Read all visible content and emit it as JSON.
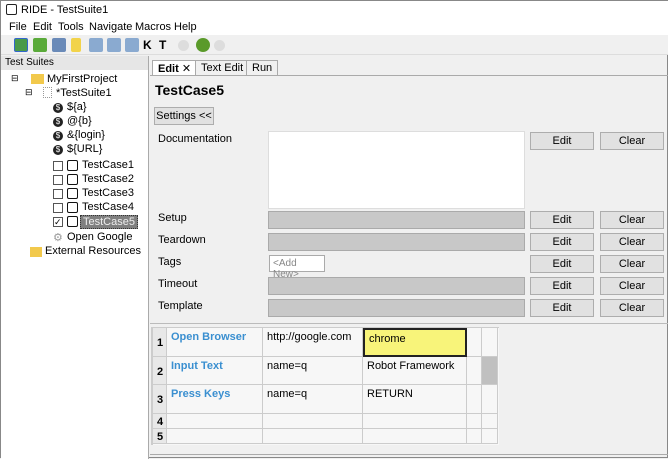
{
  "window": {
    "title": "RIDE - TestSuite1"
  },
  "menu": [
    "File",
    "Edit",
    "Tools",
    "Navigate",
    "Macros",
    "Help"
  ],
  "tree": {
    "header": "Test Suites",
    "project": "MyFirstProject",
    "suite": "*TestSuite1",
    "variables": [
      "${a}",
      "@{b}",
      "&{login}",
      "${URL}"
    ],
    "testcases": [
      {
        "name": "TestCase1",
        "checked": false
      },
      {
        "name": "TestCase2",
        "checked": false
      },
      {
        "name": "TestCase3",
        "checked": false
      },
      {
        "name": "TestCase4",
        "checked": false
      },
      {
        "name": "TestCase5",
        "checked": true
      }
    ],
    "keyword": "Open Google",
    "external": "External Resources"
  },
  "tabs": [
    "Edit",
    "Text Edit",
    "Run"
  ],
  "editor": {
    "title": "TestCase5",
    "settings_button": "Settings <<",
    "edit": "Edit",
    "clear": "Clear",
    "documentation": "Documentation",
    "setup": "Setup",
    "teardown": "Teardown",
    "tags": "Tags",
    "tags_placeholder": "<Add New>",
    "timeout": "Timeout",
    "template": "Template"
  },
  "grid": {
    "rows": [
      [
        "1",
        "Open Browser",
        "http://google.com",
        "chrome"
      ],
      [
        "2",
        "Input Text",
        "name=q",
        "Robot Framework"
      ],
      [
        "3",
        "Press Keys",
        "name=q",
        "RETURN"
      ],
      [
        "4",
        "",
        "",
        ""
      ],
      [
        "5",
        "",
        "",
        ""
      ]
    ]
  },
  "colors": {
    "keyword": "#3a8fd0",
    "selected_cell": "#f8f47a"
  }
}
